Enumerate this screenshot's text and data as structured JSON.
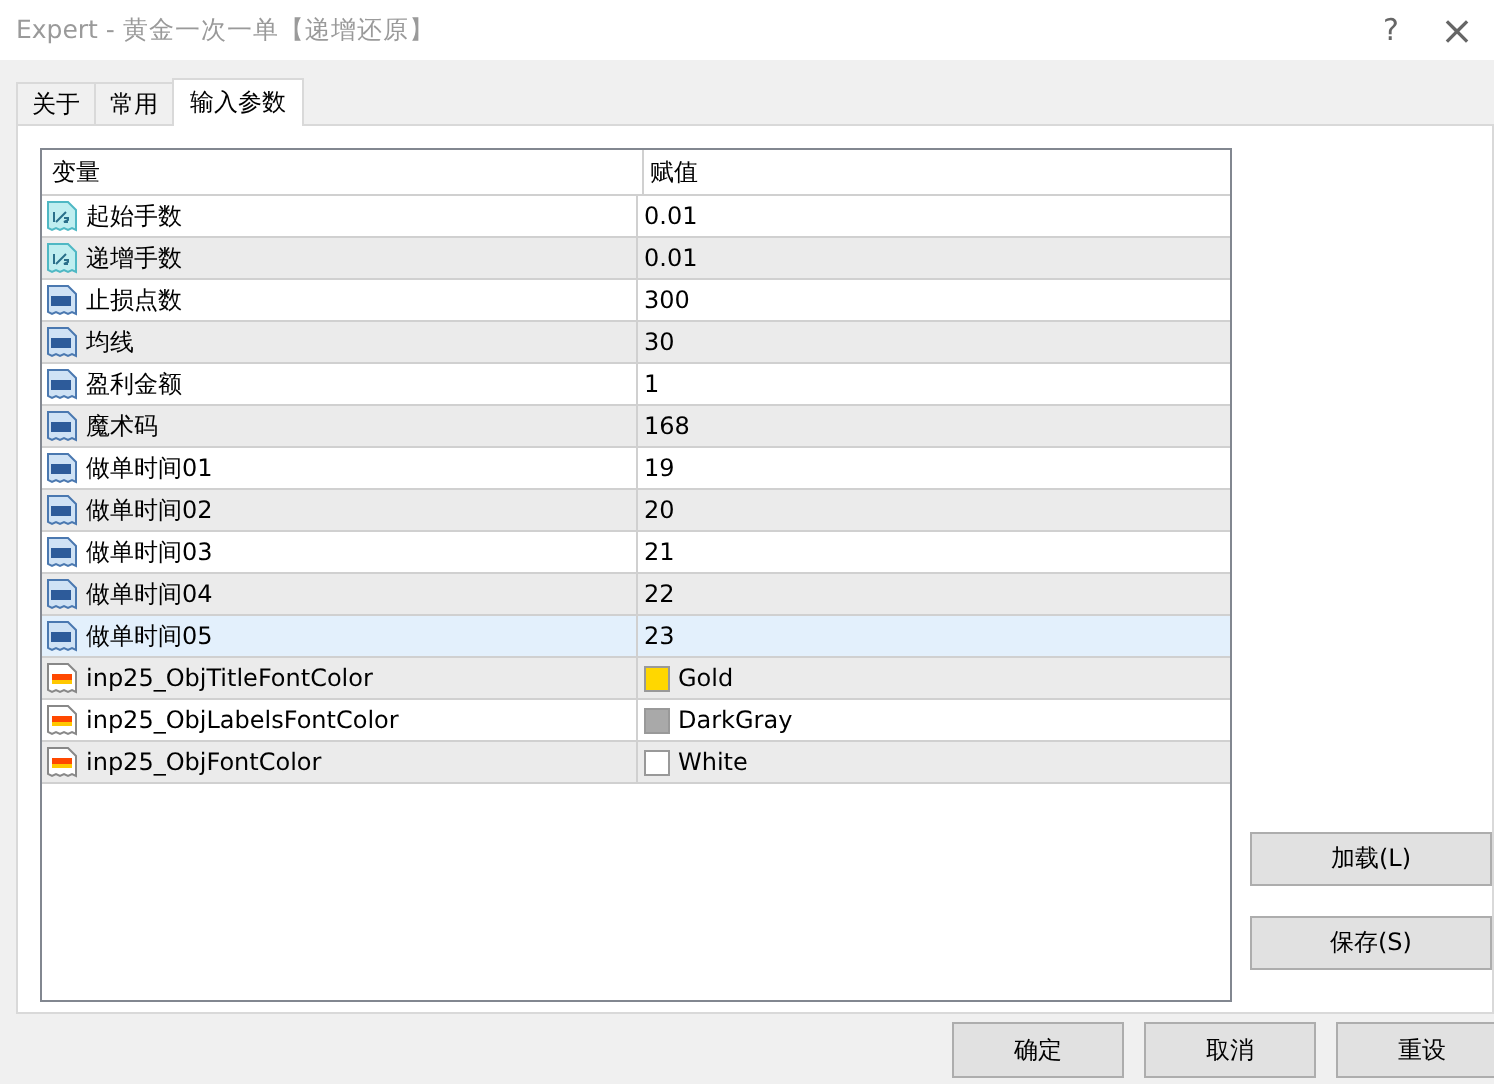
{
  "window": {
    "title": "Expert - 黄金一次一单【递增还原】",
    "help": "?",
    "close": "×"
  },
  "tabs": [
    {
      "label": "关于",
      "selected": false
    },
    {
      "label": "常用",
      "selected": false
    },
    {
      "label": "输入参数",
      "selected": true
    }
  ],
  "table": {
    "columns": [
      "变量",
      "赋值"
    ],
    "rows": [
      {
        "kind": "double",
        "name": "起始手数",
        "value": "0.01",
        "selected": false
      },
      {
        "kind": "double",
        "name": "递增手数",
        "value": "0.01",
        "selected": false
      },
      {
        "kind": "int",
        "name": "止损点数",
        "value": "300",
        "selected": false
      },
      {
        "kind": "int",
        "name": "均线",
        "value": "30",
        "selected": false
      },
      {
        "kind": "int",
        "name": "盈利金额",
        "value": "1",
        "selected": false
      },
      {
        "kind": "int",
        "name": "魔术码",
        "value": "168",
        "selected": false
      },
      {
        "kind": "int",
        "name": "做单时间01",
        "value": "19",
        "selected": false
      },
      {
        "kind": "int",
        "name": "做单时间02",
        "value": "20",
        "selected": false
      },
      {
        "kind": "int",
        "name": "做单时间03",
        "value": "21",
        "selected": false
      },
      {
        "kind": "int",
        "name": "做单时间04",
        "value": "22",
        "selected": false
      },
      {
        "kind": "int",
        "name": "做单时间05",
        "value": "23",
        "selected": true
      },
      {
        "kind": "color",
        "name": "inp25_ObjTitleFontColor",
        "value": "Gold",
        "color": "#ffd700",
        "selected": false
      },
      {
        "kind": "color",
        "name": "inp25_ObjLabelsFontColor",
        "value": "DarkGray",
        "color": "#a9a9a9",
        "selected": false
      },
      {
        "kind": "color",
        "name": "inp25_ObjFontColor",
        "value": "White",
        "color": "#ffffff",
        "selected": false
      }
    ]
  },
  "side_buttons": [
    "加载(L)",
    "保存(S)"
  ],
  "bottom_buttons": [
    "确定",
    "取消",
    "重设"
  ]
}
